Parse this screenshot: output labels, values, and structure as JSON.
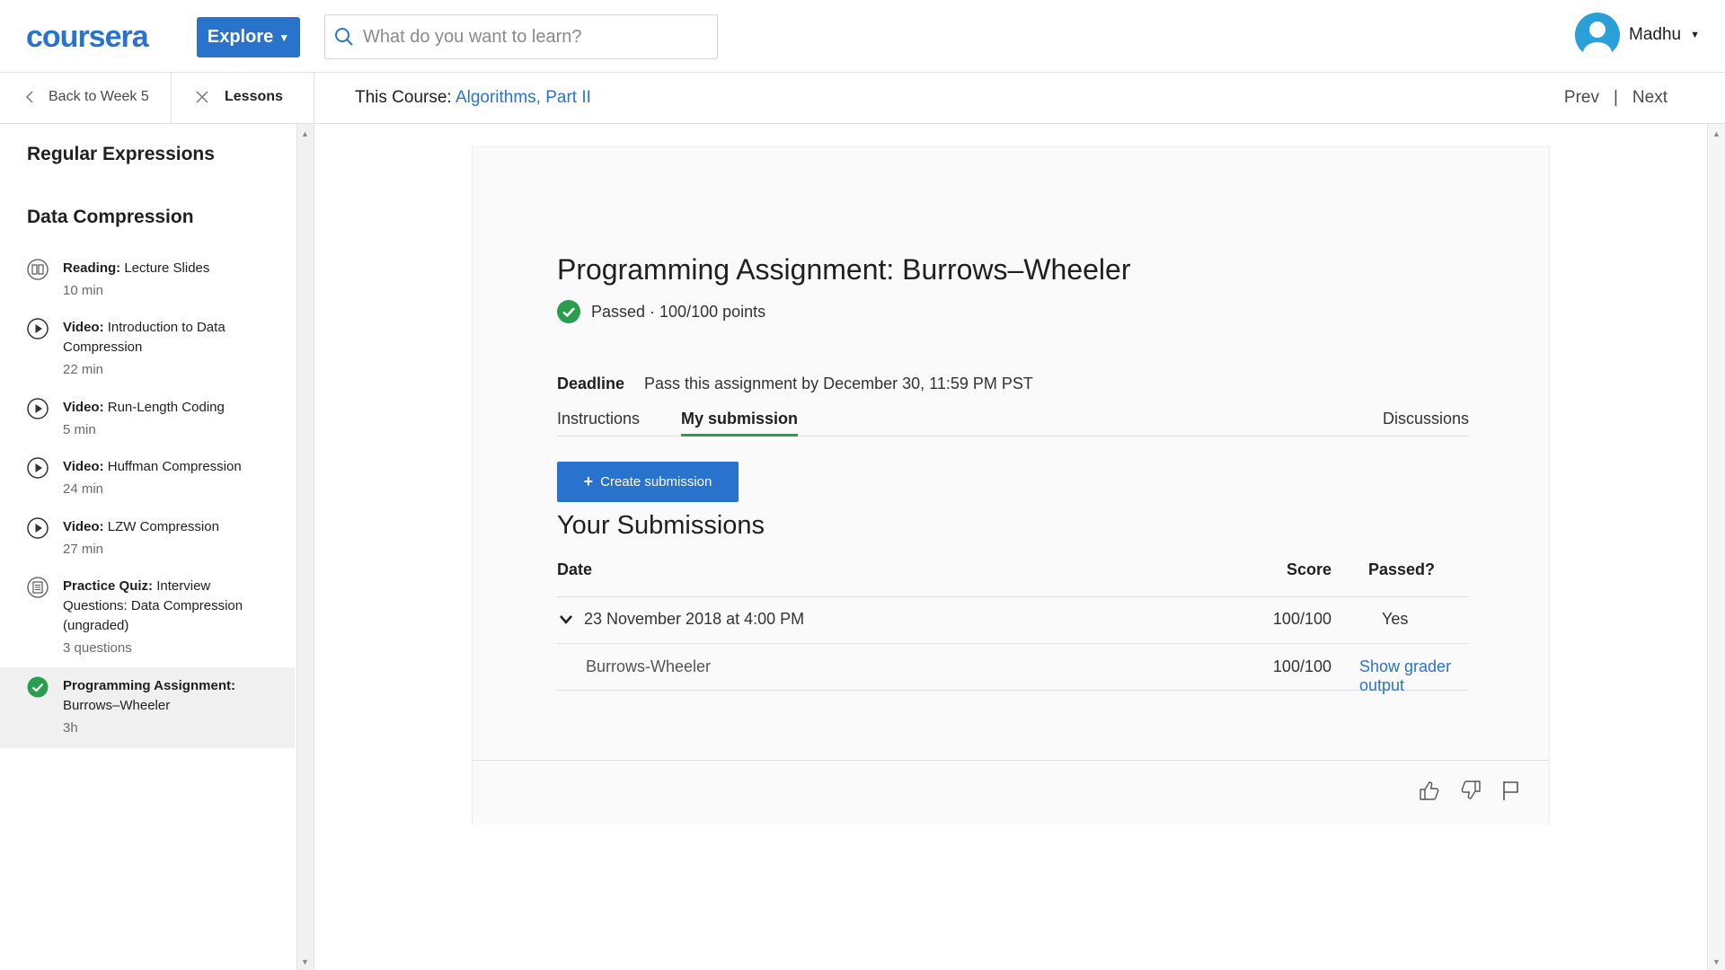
{
  "header": {
    "logo": "coursera",
    "explore_label": "Explore",
    "search_placeholder": "What do you want to learn?",
    "user_name": "Madhu"
  },
  "subheader": {
    "back_label": "Back to Week 5",
    "lessons_label": "Lessons",
    "course_prefix": "This Course: ",
    "course_name": "Algorithms, Part II",
    "prev_label": "Prev",
    "separator": "|",
    "next_label": "Next"
  },
  "sidebar": {
    "section1": "Regular Expressions",
    "section2": "Data Compression",
    "items": [
      {
        "type": "Reading:",
        "title": "Lecture Slides",
        "meta": "10 min",
        "icon": "reading-icon"
      },
      {
        "type": "Video:",
        "title": "Introduction to Data Compression",
        "meta": "22 min",
        "icon": "play-icon"
      },
      {
        "type": "Video:",
        "title": "Run-Length Coding",
        "meta": "5 min",
        "icon": "play-icon"
      },
      {
        "type": "Video:",
        "title": "Huffman Compression",
        "meta": "24 min",
        "icon": "play-icon"
      },
      {
        "type": "Video:",
        "title": "LZW Compression",
        "meta": "27 min",
        "icon": "play-icon"
      },
      {
        "type": "Practice Quiz:",
        "title": "Interview Questions: Data Compression (ungraded)",
        "meta": "3 questions",
        "icon": "quiz-icon"
      },
      {
        "type": "Programming Assignment:",
        "title": "Burrows–Wheeler",
        "meta": "3h",
        "icon": "check-circle-icon"
      }
    ]
  },
  "assignment": {
    "title": "Programming Assignment: Burrows–Wheeler",
    "status": "Passed · 100/100 points",
    "deadline_label": "Deadline",
    "deadline_text": "Pass this assignment by December 30, 11:59 PM PST"
  },
  "tabs": {
    "instructions": "Instructions",
    "my_submission": "My submission",
    "discussions": "Discussions"
  },
  "create_label": "Create submission",
  "submissions": {
    "title": "Your Submissions",
    "headers": {
      "date": "Date",
      "score": "Score",
      "passed": "Passed?"
    },
    "row": {
      "date": "23 November 2018 at 4:00 PM",
      "score": "100/100",
      "passed": "Yes"
    },
    "subrow": {
      "name": "Burrows-Wheeler",
      "score": "100/100",
      "link": "Show grader output"
    }
  },
  "colors": {
    "brand": "#2a73cc",
    "success": "#2a9d4f"
  }
}
